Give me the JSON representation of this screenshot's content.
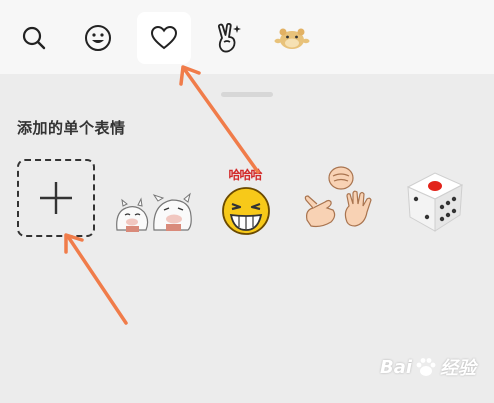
{
  "tabs": [
    {
      "icon": "search-icon",
      "active": false
    },
    {
      "icon": "smiley-icon",
      "active": false
    },
    {
      "icon": "heart-icon",
      "active": true
    },
    {
      "icon": "victory-hand-icon",
      "active": false
    },
    {
      "icon": "hamster-sticker-icon",
      "active": false
    }
  ],
  "section": {
    "title": "添加的单个表情"
  },
  "stickers": [
    {
      "name": "add-sticker",
      "icon": "plus-icon"
    },
    {
      "name": "cow-couple-sticker"
    },
    {
      "name": "haha-face-sticker",
      "caption": "哈哈哈"
    },
    {
      "name": "rock-paper-scissors-sticker"
    },
    {
      "name": "dice-sticker"
    }
  ],
  "watermark": {
    "brand": "Bai",
    "suffix": "经验"
  },
  "colors": {
    "arrow": "#f07c4a",
    "active_tab": "#ffffff",
    "panel": "#ececec"
  }
}
